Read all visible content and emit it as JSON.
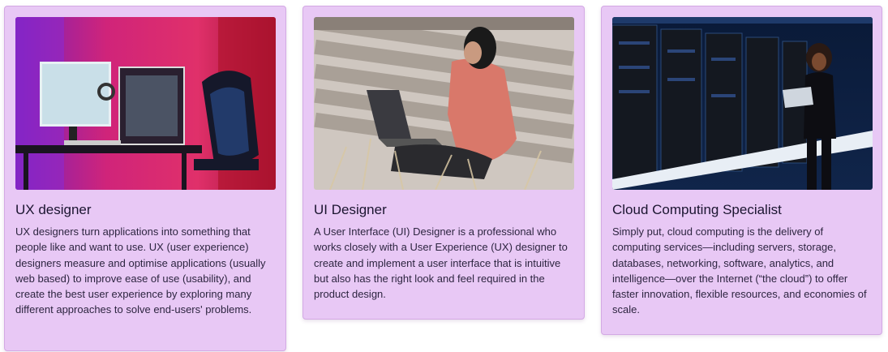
{
  "cards": [
    {
      "image": "gaming-desk-photo",
      "title": "UX designer",
      "text": "UX designers turn applications into something that people like and want to use. UX (user experience) designers measure and optimise applications (usually web based) to improve ease of use (usability), and create the best user experience by exploring many different approaches to solve end-users' problems."
    },
    {
      "image": "woman-laptop-bench-photo",
      "title": "UI Designer",
      "text": "A User Interface (UI) Designer is a professional who works closely with a User Experience (UX) designer to create and implement a user interface that is intuitive but also has the right look and feel required in the product design."
    },
    {
      "image": "server-room-photo",
      "title": "Cloud Computing Specialist",
      "text": "Simply put, cloud computing is the delivery of computing services—including servers, storage, databases, networking, software, analytics, and intelligence—over the Internet (“the cloud”) to offer faster innovation, flexible resources, and economies of scale."
    }
  ],
  "colors": {
    "card_background": "#e8c8f5",
    "card_border": "#d3a9e4",
    "title_text": "#1b1530",
    "body_text": "#2d2540"
  }
}
